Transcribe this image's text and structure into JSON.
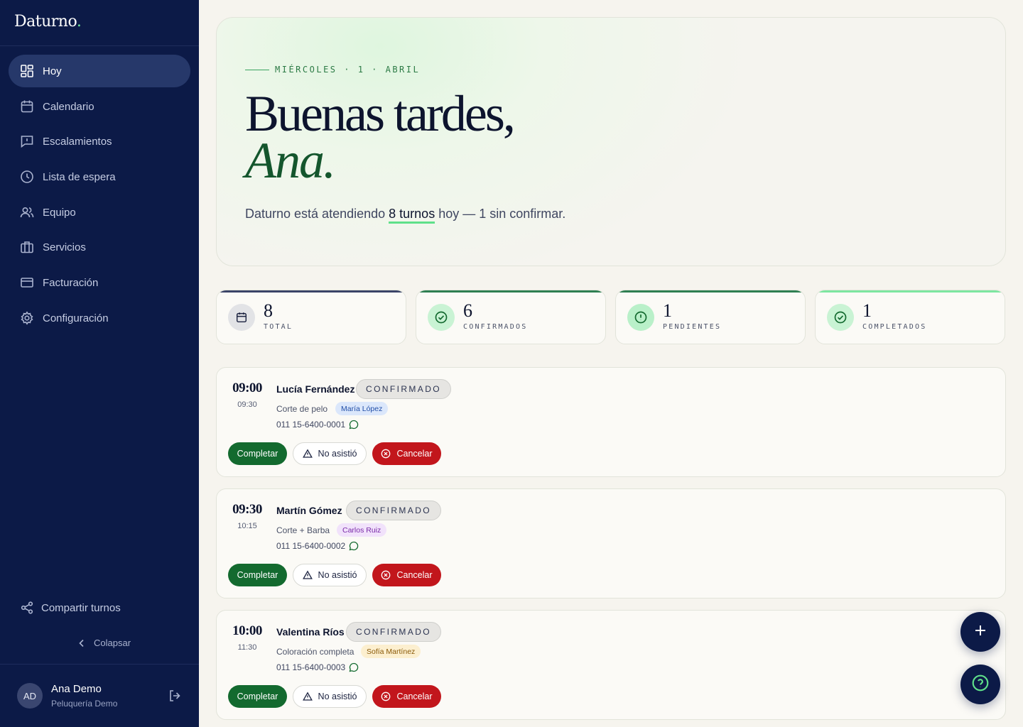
{
  "brand": {
    "name": "Daturno",
    "dot": "."
  },
  "sidebar": {
    "items": [
      {
        "label": "Hoy",
        "icon": "dashboard-icon",
        "active": true
      },
      {
        "label": "Calendario",
        "icon": "calendar-icon"
      },
      {
        "label": "Escalamientos",
        "icon": "message-alert-icon"
      },
      {
        "label": "Lista de espera",
        "icon": "clock-icon"
      },
      {
        "label": "Equipo",
        "icon": "users-icon"
      },
      {
        "label": "Servicios",
        "icon": "briefcase-icon"
      },
      {
        "label": "Facturación",
        "icon": "credit-card-icon"
      },
      {
        "label": "Configuración",
        "icon": "gear-icon"
      }
    ],
    "share_label": "Compartir turnos",
    "collapse_label": "Colapsar",
    "user": {
      "initials": "AD",
      "name": "Ana Demo",
      "business": "Peluquería Demo"
    }
  },
  "hero": {
    "date": "MIÉRCOLES · 1 · ABRIL",
    "greeting": "Buenas tardes,",
    "name": "Ana.",
    "sub_before": "Daturno está atendiendo ",
    "sub_highlight": "8 turnos",
    "sub_after": " hoy — 1 sin confirmar."
  },
  "stats": [
    {
      "value": "8",
      "label": "TOTAL",
      "icon": "calendar-icon",
      "color": "#3b4468"
    },
    {
      "value": "6",
      "label": "CONFIRMADOS",
      "icon": "check-circle-icon",
      "color": "#2f7f52"
    },
    {
      "value": "1",
      "label": "PENDIENTES",
      "icon": "alert-circle-icon",
      "color": "#2f7f52"
    },
    {
      "value": "1",
      "label": "COMPLETADOS",
      "icon": "check-circle-icon",
      "color": "#7de6a0"
    }
  ],
  "appointments": [
    {
      "start": "09:00",
      "end": "09:30",
      "client": "Lucía Fernández",
      "status": "CONFIRMADO",
      "service": "Corte de pelo",
      "staff": "María López",
      "staff_color": "blue",
      "phone": "011 15-6400-0001"
    },
    {
      "start": "09:30",
      "end": "10:15",
      "client": "Martín Gómez",
      "status": "CONFIRMADO",
      "service": "Corte + Barba",
      "staff": "Carlos Ruiz",
      "staff_color": "purple",
      "phone": "011 15-6400-0002"
    },
    {
      "start": "10:00",
      "end": "11:30",
      "client": "Valentina Ríos",
      "status": "CONFIRMADO",
      "service": "Coloración completa",
      "staff": "Sofía Martínez",
      "staff_color": "yellow",
      "phone": "011 15-6400-0003"
    }
  ],
  "actions": {
    "complete": "Completar",
    "no_show": "No asistió",
    "cancel": "Cancelar"
  },
  "colors": {
    "sidebar_bg": "#0c1a47",
    "accent_green": "#136a2f",
    "danger": "#c2161c",
    "highlight": "#5fe08a"
  }
}
